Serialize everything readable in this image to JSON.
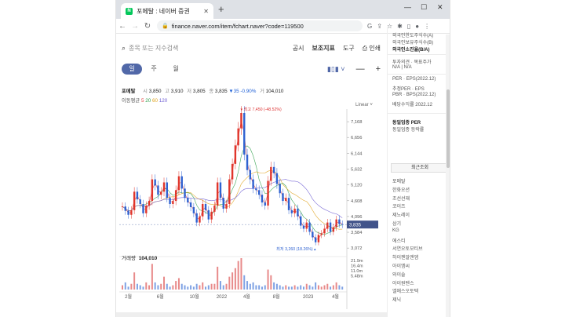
{
  "browser": {
    "tab_title": "포메탈 : 네이버 증권",
    "favicon": "N",
    "url": "finance.naver.com/item/fchart.naver?code=119500"
  },
  "page": {
    "search_placeholder": "종목 또는 지수검색",
    "menu": [
      "공시",
      "보조지표",
      "도구",
      "인쇄"
    ],
    "periods": [
      "일",
      "주",
      "월"
    ],
    "active_period": "일",
    "quote": {
      "name": "포메탈",
      "open_label": "시",
      "open": "3,850",
      "high_label": "고",
      "high": "3,910",
      "low_label": "저",
      "low": "3,805",
      "close_label": "종",
      "close": "3,835",
      "change": "▼35",
      "change_pct": "-0.90%",
      "volume_label": "거",
      "volume": "104,010"
    },
    "ma": {
      "label": "이동평균",
      "v5": "5",
      "v20": "20",
      "v60": "60",
      "v120": "120"
    },
    "scale": "Linear",
    "volume_title": "거래량",
    "volume_value": "104,010"
  },
  "chart_data": {
    "type": "candlestick",
    "y_ticks": [
      "7,168",
      "6,656",
      "6,144",
      "5,632",
      "5,120",
      "4,608",
      "4,096",
      "3,584",
      "3,072"
    ],
    "current_price_label": "3,835",
    "max_annotation": "최고 7,450 (-48.52%)",
    "min_annotation": "최저 3,260 (18.26%)",
    "x_ticks": [
      "2월",
      "6월",
      "10월",
      "2022",
      "4월",
      "8월",
      "2023",
      "4월"
    ],
    "volume_ticks": [
      "21.9m",
      "16.4m",
      "11.0m",
      "5.48m"
    ],
    "close_series": [
      4420,
      4280,
      4150,
      4300,
      4900,
      4650,
      4500,
      4200,
      4450,
      4600,
      5300,
      5100,
      4800,
      4900,
      5200,
      4700,
      4500,
      4600,
      4950,
      5400,
      5000,
      4700,
      4550,
      4400,
      4200,
      3900,
      4100,
      4500,
      4300,
      4000,
      4250,
      4450,
      5200,
      4700,
      4350,
      4500,
      5300,
      5800,
      6400,
      6950,
      7450,
      6100,
      5600,
      5300,
      5000,
      4950,
      4800,
      4550,
      4450,
      5250,
      5700,
      5500,
      5150,
      4850,
      4600,
      4700,
      4300,
      4200,
      4350,
      4100,
      3800,
      3700,
      3900,
      3600,
      3420,
      3260,
      3500,
      3550,
      3700,
      3900,
      3600,
      3750,
      4000,
      3850,
      3835
    ],
    "volume_bars": [
      3,
      5,
      2,
      4,
      12,
      4,
      3,
      2,
      5,
      3,
      18,
      5,
      3,
      4,
      9,
      4,
      2,
      3,
      6,
      8,
      4,
      3,
      2,
      3,
      2,
      4,
      3,
      5,
      2,
      3,
      4,
      4,
      16,
      6,
      3,
      4,
      9,
      12,
      15,
      20,
      22,
      10,
      6,
      4,
      5,
      3,
      3,
      2,
      3,
      14,
      10,
      5,
      4,
      3,
      2,
      3,
      2,
      2,
      3,
      2,
      3,
      2,
      4,
      3,
      2,
      5,
      3,
      2,
      3,
      4,
      2,
      3,
      5,
      3,
      2
    ]
  },
  "sidebar": {
    "top_items": [
      "외국인한도주식수(A)",
      "외국인보유주식수(B)",
      "외국인소진율(B/A)"
    ],
    "invest_label": "투자의견",
    "target_label": "목표주가",
    "invest_values": "N/A  |  N/A",
    "per_rows": [
      [
        "PER",
        "EPS(2022.12)"
      ],
      [
        "추정PER",
        "EPS"
      ],
      [
        "PBR",
        "BPS(2022.12)"
      ],
      [
        "배당수익률",
        "2022.12"
      ]
    ],
    "industry_label": "동일업종 PER",
    "industry_rate": "동일업종 등락률",
    "recent_title": "최근조회",
    "recent_items": [
      "포메탈",
      "한화오션",
      "조선선재",
      "코이즈",
      "제노레이",
      "삼기",
      "KG",
      "에스티",
      "서연오토모티브",
      "하이젠알앤엠",
      "아이엠씨",
      "와이솔",
      "아이원텐스",
      "엘에스오토텍",
      "제닉"
    ]
  }
}
